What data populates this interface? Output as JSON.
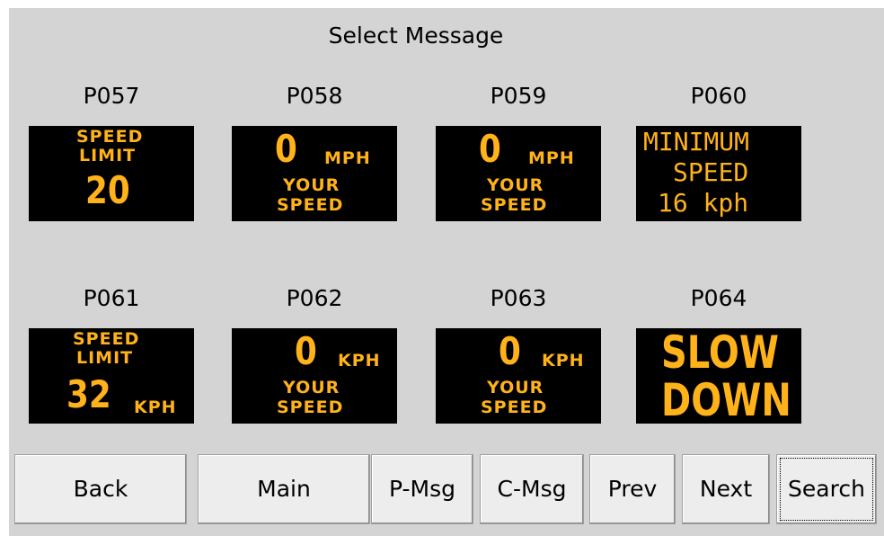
{
  "title": "Select Message",
  "messages": [
    {
      "code": "P057",
      "lines": [
        "SPEED",
        "LIMIT",
        "20"
      ]
    },
    {
      "code": "P058",
      "lines": [
        "0",
        "MPH",
        "YOUR",
        "SPEED"
      ]
    },
    {
      "code": "P059",
      "lines": [
        "0",
        "MPH",
        "YOUR",
        "SPEED"
      ]
    },
    {
      "code": "P060",
      "lines": [
        "MINIMUM",
        "SPEED",
        "16 kph"
      ]
    },
    {
      "code": "P061",
      "lines": [
        "SPEED",
        "LIMIT",
        "32",
        "KPH"
      ]
    },
    {
      "code": "P062",
      "lines": [
        "0",
        "KPH",
        "YOUR",
        "SPEED"
      ]
    },
    {
      "code": "P063",
      "lines": [
        "0",
        "KPH",
        "YOUR",
        "SPEED"
      ]
    },
    {
      "code": "P064",
      "lines": [
        "SLOW",
        "DOWN"
      ]
    }
  ],
  "buttons": {
    "back": "Back",
    "main": "Main",
    "pmsg": "P-Msg",
    "cmsg": "C-Msg",
    "prev": "Prev",
    "next": "Next",
    "search": "Search"
  },
  "colors": {
    "background": "#d4d4d4",
    "sign_background": "#000000",
    "sign_text": "#ffb21a",
    "button": "#ededed"
  }
}
